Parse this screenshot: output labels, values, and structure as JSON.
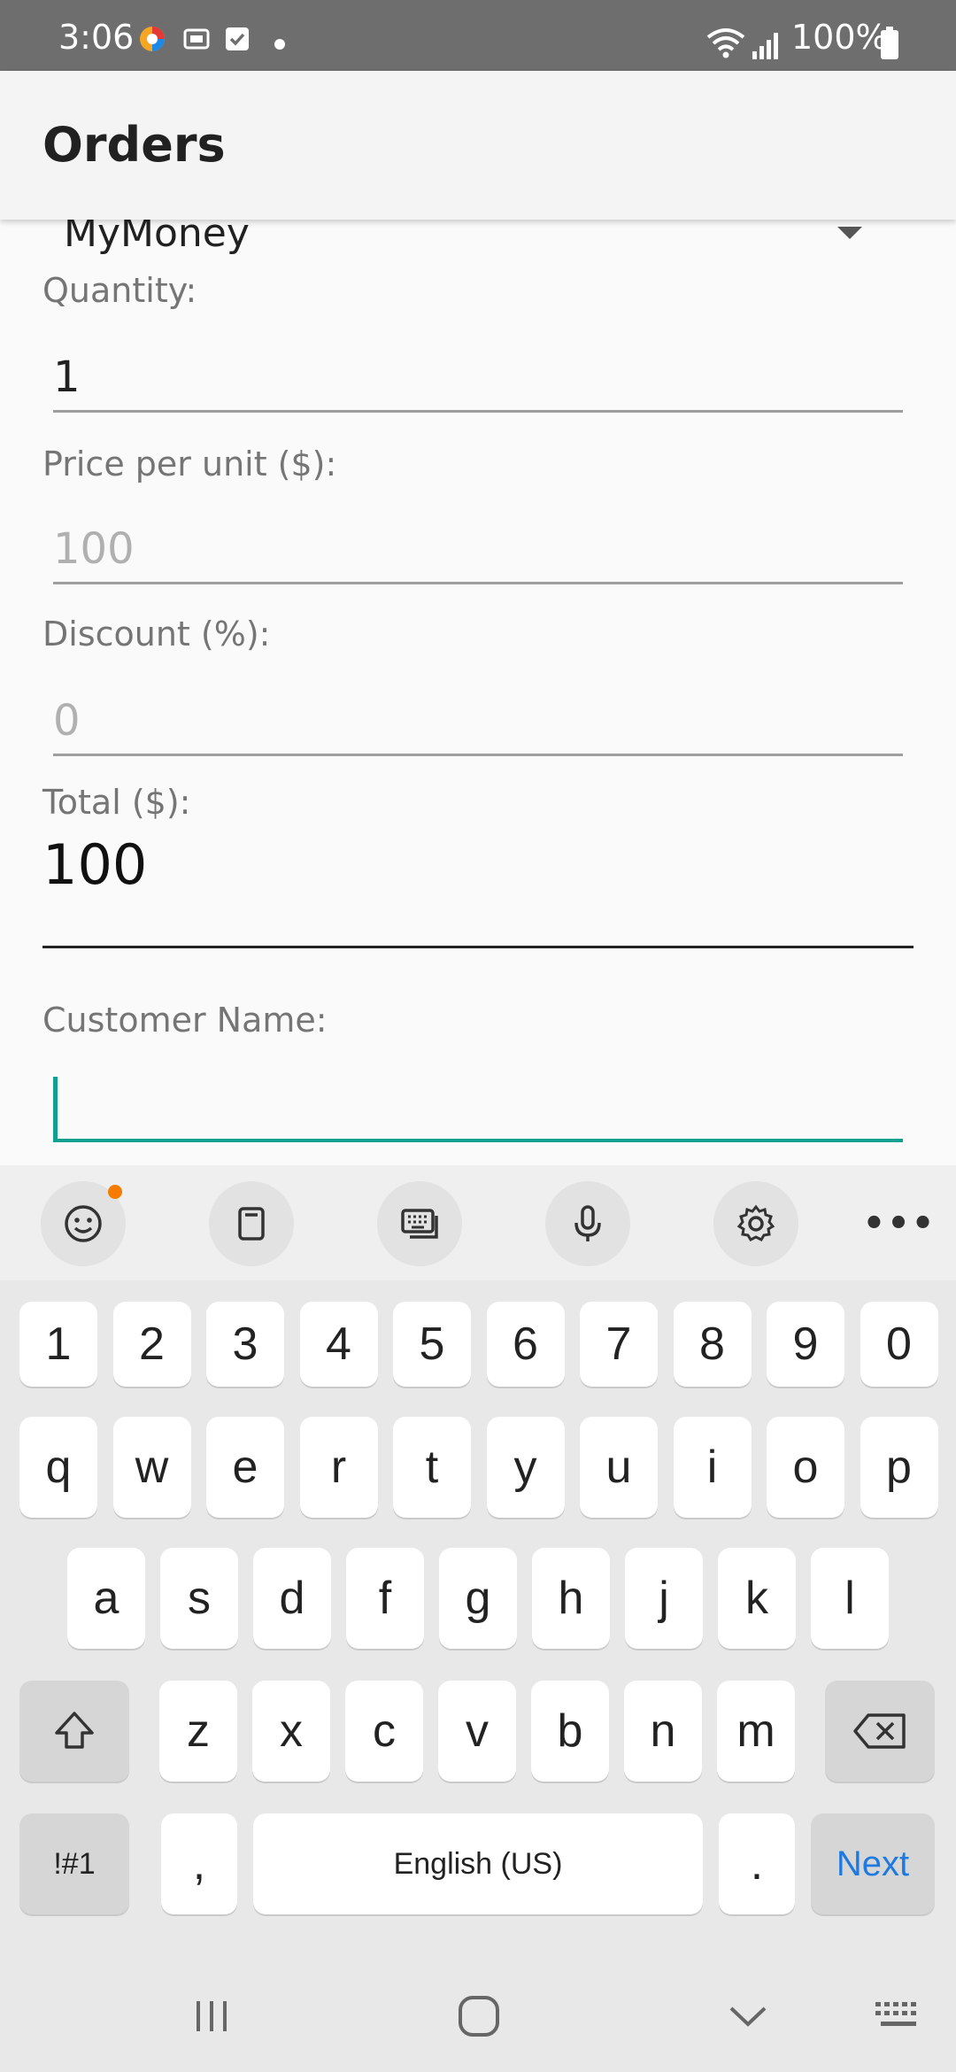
{
  "status_bar": {
    "time": "3:06",
    "battery": "100%",
    "icons": [
      "browser-app-icon",
      "cast-icon",
      "checkbox-icon",
      "notification-dot",
      "wifi-icon",
      "signal-icon",
      "battery-icon"
    ]
  },
  "app_bar": {
    "title": "Orders"
  },
  "form": {
    "product_picker_value": "MyMoney",
    "quantity_label": "Quantity:",
    "quantity_value": "1",
    "price_label": "Price per unit ($):",
    "price_placeholder": "100",
    "discount_label": "Discount (%):",
    "discount_placeholder": "0",
    "total_label": "Total ($):",
    "total_value": "100",
    "customer_label": "Customer Name:",
    "customer_value": ""
  },
  "keyboard": {
    "toolbar_icons": [
      "emoji-icon",
      "clipboard-icon",
      "keyboard-mode-icon",
      "microphone-icon",
      "settings-icon",
      "more-icon"
    ],
    "more_label": "•••",
    "row_numbers": [
      "1",
      "2",
      "3",
      "4",
      "5",
      "6",
      "7",
      "8",
      "9",
      "0"
    ],
    "row_1": [
      "q",
      "w",
      "e",
      "r",
      "t",
      "y",
      "u",
      "i",
      "o",
      "p"
    ],
    "row_2": [
      "a",
      "s",
      "d",
      "f",
      "g",
      "h",
      "j",
      "k",
      "l"
    ],
    "row_3": [
      "z",
      "x",
      "c",
      "v",
      "b",
      "n",
      "m"
    ],
    "symbols_label": "!#1",
    "comma_label": ",",
    "space_label": "English (US)",
    "period_label": ".",
    "next_label": "Next"
  },
  "colors": {
    "accent": "#11a08f",
    "next": "#1e7ae0",
    "status_bar": "#6e6e6e"
  }
}
